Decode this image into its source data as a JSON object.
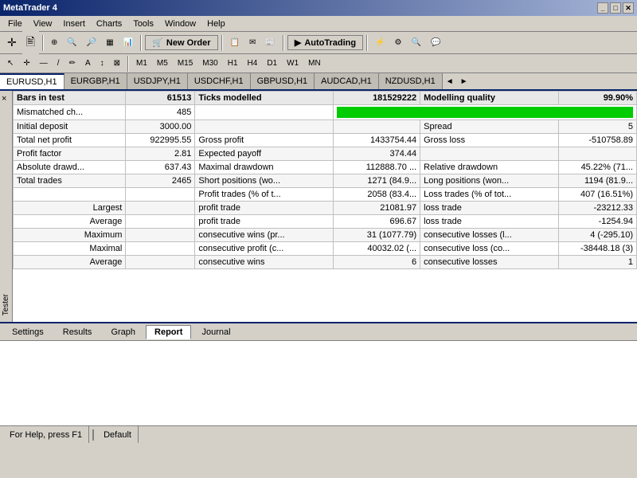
{
  "app": {
    "title": "MetaTrader 4",
    "title_buttons": [
      "_",
      "□",
      "✕"
    ]
  },
  "menu": {
    "items": [
      "File",
      "View",
      "Insert",
      "Charts",
      "Tools",
      "Window",
      "Help"
    ]
  },
  "toolbar": {
    "new_order_label": "New Order",
    "autotrading_label": "AutoTrading"
  },
  "timeframes": [
    "M1",
    "M5",
    "M15",
    "M30",
    "H1",
    "H4",
    "D1",
    "W1",
    "MN"
  ],
  "symbol_tabs": {
    "items": [
      "EURUSD,H1",
      "EURGBP,H1",
      "USDJPY,H1",
      "USDCHF,H1",
      "GBPUSD,H1",
      "AUDCAD,H1",
      "NZDUSD,H1"
    ],
    "active": "EURUSD,H1"
  },
  "report_table": {
    "rows": [
      {
        "col1_label": "Bars in test",
        "col1_value": "61513",
        "col2_label": "Ticks modelled",
        "col2_value": "181529222",
        "col3_label": "Modelling quality",
        "col3_value": "99.90%"
      },
      {
        "col1_label": "Mismatched ch...",
        "col1_value": "485",
        "col2_label": "",
        "col2_value": "GREEN_BAR",
        "col3_label": "",
        "col3_value": ""
      },
      {
        "col1_label": "Initial deposit",
        "col1_value": "3000.00",
        "col2_label": "",
        "col2_value": "",
        "col3_label": "Spread",
        "col3_value": "5"
      },
      {
        "col1_label": "Total net profit",
        "col1_value": "922995.55",
        "col2_label": "Gross profit",
        "col2_value": "1433754.44",
        "col3_label": "Gross loss",
        "col3_value": "-510758.89"
      },
      {
        "col1_label": "Profit factor",
        "col1_value": "2.81",
        "col2_label": "Expected payoff",
        "col2_value": "374.44",
        "col3_label": "",
        "col3_value": ""
      },
      {
        "col1_label": "Absolute drawd...",
        "col1_value": "637.43",
        "col2_label": "Maximal drawdown",
        "col2_value": "112888.70 ...",
        "col3_label": "Relative drawdown",
        "col3_value": "45.22% (71..."
      },
      {
        "col1_label": "Total trades",
        "col1_value": "2465",
        "col2_label": "Short positions (wo...",
        "col2_value": "1271 (84.9...",
        "col3_label": "Long positions (won...",
        "col3_value": "1194 (81.9..."
      },
      {
        "col1_label": "",
        "col1_value": "",
        "col2_label": "Profit trades (% of t...",
        "col2_value": "2058 (83.4...",
        "col3_label": "Loss trades (% of tot...",
        "col3_value": "407 (16.51%)"
      },
      {
        "col1_label": "Largest",
        "col1_value": "",
        "col2_label": "profit trade",
        "col2_value": "21081.97",
        "col3_label": "loss trade",
        "col3_value": "-23212.33"
      },
      {
        "col1_label": "Average",
        "col1_value": "",
        "col2_label": "profit trade",
        "col2_value": "696.67",
        "col3_label": "loss trade",
        "col3_value": "-1254.94"
      },
      {
        "col1_label": "Maximum",
        "col1_value": "",
        "col2_label": "consecutive wins (pr...",
        "col2_value": "31 (1077.79)",
        "col3_label": "consecutive losses (l...",
        "col3_value": "4 (-295.10)"
      },
      {
        "col1_label": "Maximal",
        "col1_value": "",
        "col2_label": "consecutive profit (c...",
        "col2_value": "40032.02 (...",
        "col3_label": "consecutive loss (co...",
        "col3_value": "-38448.18 (3)"
      },
      {
        "col1_label": "Average",
        "col1_value": "",
        "col2_label": "consecutive wins",
        "col2_value": "6",
        "col3_label": "consecutive losses",
        "col3_value": "1"
      }
    ]
  },
  "bottom_tabs": {
    "items": [
      "Settings",
      "Results",
      "Graph",
      "Report",
      "Journal"
    ],
    "active": "Report"
  },
  "status_bar": {
    "help_text": "For Help, press F1",
    "default_text": "Default"
  },
  "tester_label": "Tester",
  "close_x": "×"
}
